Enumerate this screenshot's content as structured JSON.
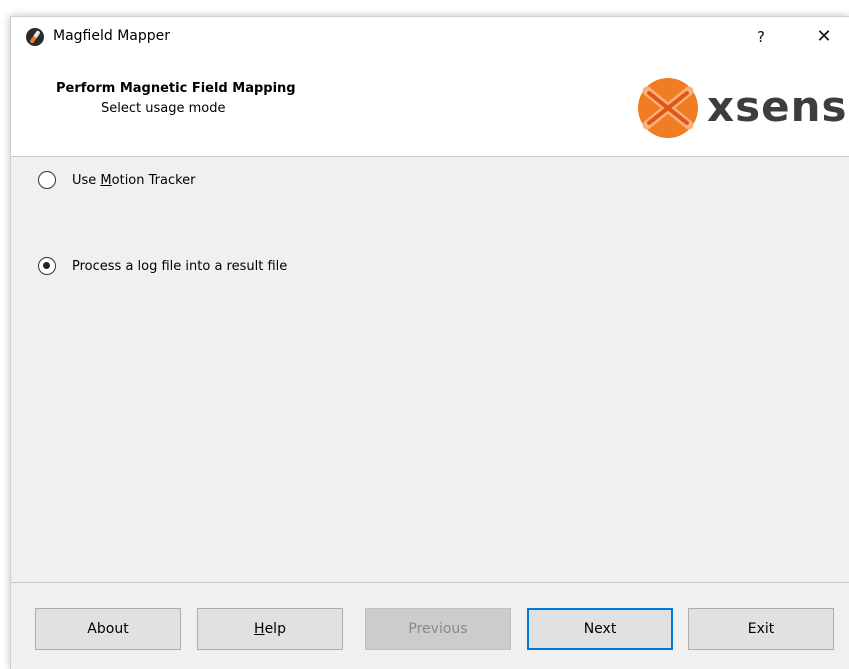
{
  "window": {
    "title": "Magfield Mapper",
    "help_button": "?",
    "close_button": "✕"
  },
  "header": {
    "title": "Perform Magnetic Field Mapping",
    "subtitle": "Select usage mode",
    "logo_text": "xsens"
  },
  "options": [
    {
      "label_pre": "Use ",
      "label_mnemonic": "M",
      "label_post": "otion Tracker",
      "checked": false
    },
    {
      "label": "Process a log file into a result file",
      "checked": true
    }
  ],
  "buttons": {
    "about": "About",
    "help_mnemonic": "H",
    "help_rest": "elp",
    "previous": "Previous",
    "next": "Next",
    "exit": "Exit"
  },
  "colors": {
    "accent": "#0078d7",
    "logo_orange": "#f07c24"
  }
}
